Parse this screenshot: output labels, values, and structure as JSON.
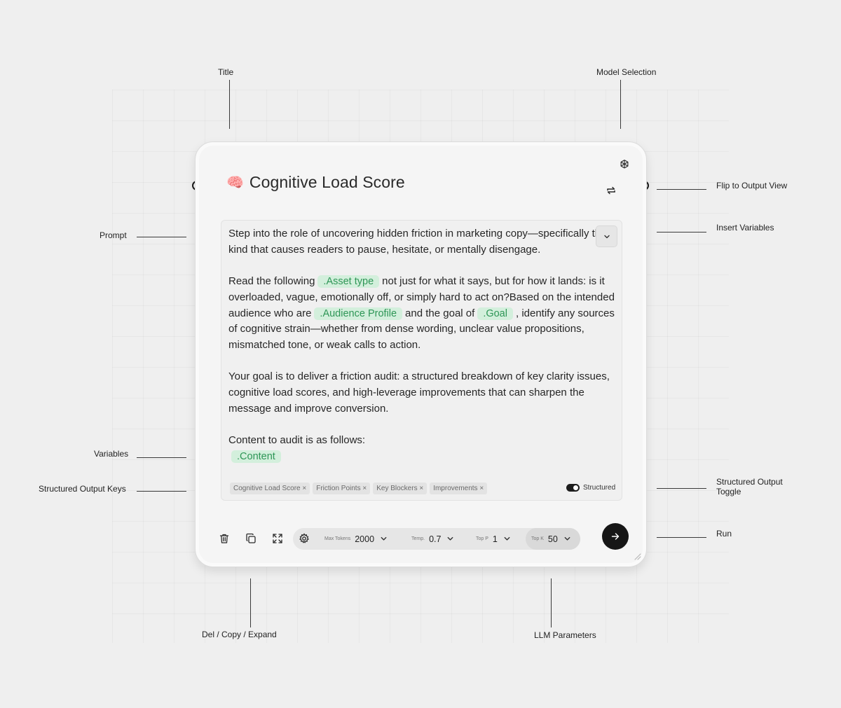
{
  "annotations": {
    "title": "Title",
    "model_selection": "Model Selection",
    "flip_to_output": "Flip to Output View",
    "prompt": "Prompt",
    "insert_variables": "Insert Variables",
    "variables": "Variables",
    "structured_output_keys": "Structured Output Keys",
    "structured_output_toggle_line1": "Structured Output",
    "structured_output_toggle_line2": "Toggle",
    "run": "Run",
    "del_copy_expand": "Del / Copy / Expand",
    "llm_parameters": "LLM Parameters"
  },
  "card": {
    "emoji": "🧠",
    "title": "Cognitive Load Score"
  },
  "prompt": {
    "p1": "Step into the role of uncovering hidden friction in marketing copy—specifically the kind that causes readers to pause, hesitate, or mentally disengage.",
    "p2_a": "Read the following",
    "var_asset": ".Asset type",
    "p2_b": "not just for what it says, but for how it lands: is it overloaded, vague, emotionally off, or simply hard to act on?Based on the intended audience who are",
    "var_audience": ".Audience Profile",
    "p2_c": "and the goal of",
    "var_goal": ".Goal",
    "p2_d": ", identify any sources of cognitive strain—whether from dense wording, unclear value propositions, mismatched tone, or weak calls to action.",
    "p3": "Your goal is to deliver a friction audit: a structured breakdown of key clarity issues, cognitive load scores, and high-leverage improvements that can sharpen the message and improve conversion.",
    "p4": "Content to audit is as follows:",
    "var_content": ".Content"
  },
  "structured_keys": [
    "Cognitive Load Score ×",
    "Friction Points ×",
    "Key Blockers ×",
    "Improvements ×"
  ],
  "structured_toggle": {
    "label": "Structured",
    "on": true
  },
  "params": {
    "max_tokens_label": "Max Tokens",
    "max_tokens": "2000",
    "temp_label": "Temp.",
    "temp": "0.7",
    "top_p_label": "Top P",
    "top_p": "1",
    "top_k_label": "Top K",
    "top_k": "50"
  },
  "icons": {
    "model": "openai-logo-icon",
    "flip": "swap-arrows-icon",
    "insert": "chevron-down-icon",
    "delete": "trash-icon",
    "copy": "copy-icon",
    "expand": "expand-icon",
    "settings": "gear-icon",
    "run": "arrow-right-icon"
  },
  "colors": {
    "variable_bg": "#d3efdc",
    "variable_text": "#2e9656",
    "run_button": "#161616"
  }
}
